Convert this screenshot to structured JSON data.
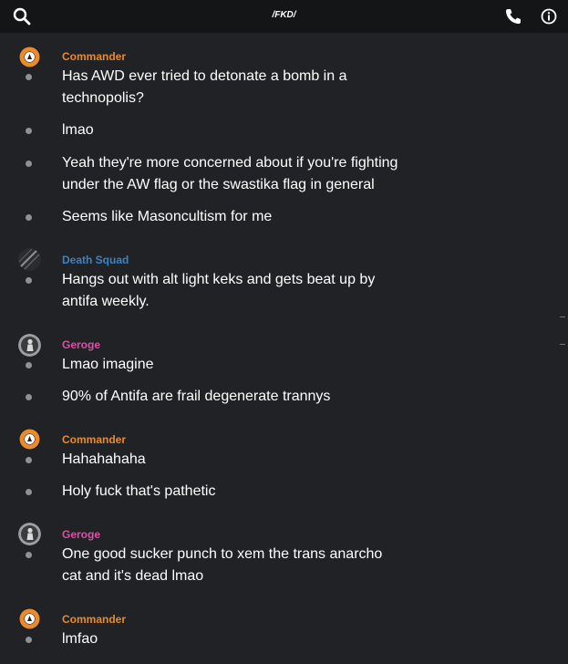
{
  "header": {
    "title": "/FKD/",
    "search_icon": "search-icon",
    "call_icon": "phone-icon",
    "info_icon": "info-icon"
  },
  "users": {
    "commander": {
      "name": "Commander",
      "color": "#e98a2c",
      "avatar_icon": "orange-spiral-avatar"
    },
    "deathsquad": {
      "name": "Death Squad",
      "color": "#3d83c4",
      "avatar_icon": "dark-striped-avatar"
    },
    "geroge": {
      "name": "Geroge",
      "color": "#d653a6",
      "avatar_icon": "grey-figure-avatar"
    }
  },
  "messages": [
    {
      "sender": "Commander",
      "lines": [
        "Has AWD ever tried to detonate a bomb in a",
        "technopolis?"
      ]
    },
    {
      "sender": "",
      "lines": [
        "lmao"
      ]
    },
    {
      "sender": "",
      "lines": [
        "Yeah they're more concerned about if you're fighting",
        "under the AW flag or the swastika flag in general"
      ]
    },
    {
      "sender": "",
      "lines": [
        "Seems like Masoncultism for me"
      ]
    },
    {
      "sender": "Death Squad",
      "lines": [
        "Hangs out with alt light keks and gets beat up by",
        "antifa weekly."
      ]
    },
    {
      "sender": "Geroge",
      "lines": [
        "Lmao imagine"
      ]
    },
    {
      "sender": "",
      "lines": [
        "90% of Antifa are frail degenerate trannys"
      ]
    },
    {
      "sender": "Commander",
      "lines": [
        "Hahahahaha"
      ]
    },
    {
      "sender": "",
      "lines": [
        "Holy fuck that's pathetic"
      ]
    },
    {
      "sender": "Geroge",
      "lines": [
        "One good sucker punch to xem the trans anarcho",
        "cat and it's dead lmao"
      ]
    },
    {
      "sender": "Commander",
      "lines": [
        "lmfao"
      ]
    }
  ]
}
